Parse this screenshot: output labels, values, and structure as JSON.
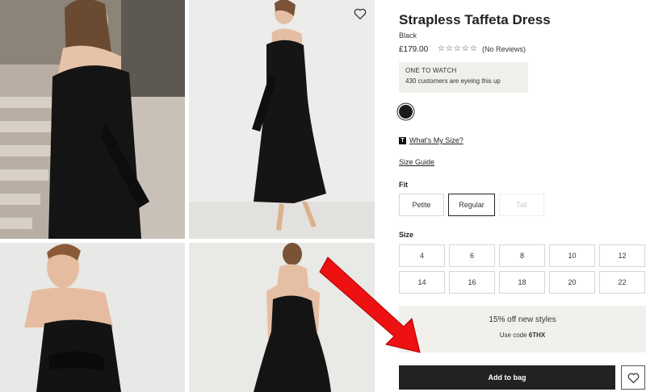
{
  "product": {
    "title": "Strapless Taffeta Dress",
    "color": "Black",
    "price": "£179.00",
    "rating_stars": "☆☆☆☆☆",
    "reviews": "(No Reviews)"
  },
  "watch": {
    "heading": "ONE TO WATCH",
    "text": "430 customers are eyeing this up"
  },
  "swatch": {
    "color": "#1a1a1a",
    "name": "Black"
  },
  "links": {
    "whats_my_size_icon": "T",
    "whats_my_size": "What's My Size?",
    "size_guide": "Size Guide"
  },
  "fit": {
    "label": "Fit",
    "options": [
      "Petite",
      "Regular",
      "Tall"
    ],
    "selected": "Regular",
    "unavailable": "Tall"
  },
  "size": {
    "label": "Size",
    "options": [
      "4",
      "6",
      "8",
      "10",
      "12",
      "14",
      "16",
      "18",
      "20",
      "22"
    ]
  },
  "promo": {
    "title": "15% off new styles",
    "code_prefix": "Use code ",
    "code": "6THX"
  },
  "actions": {
    "add_to_bag": "Add to bag"
  },
  "icons": {
    "wishlist": "heart-icon",
    "annotation": "red-arrow"
  },
  "colors": {
    "bag_button": "#222222",
    "promo_bg": "#f2f0ed",
    "annotation_arrow": "#ee1111"
  }
}
